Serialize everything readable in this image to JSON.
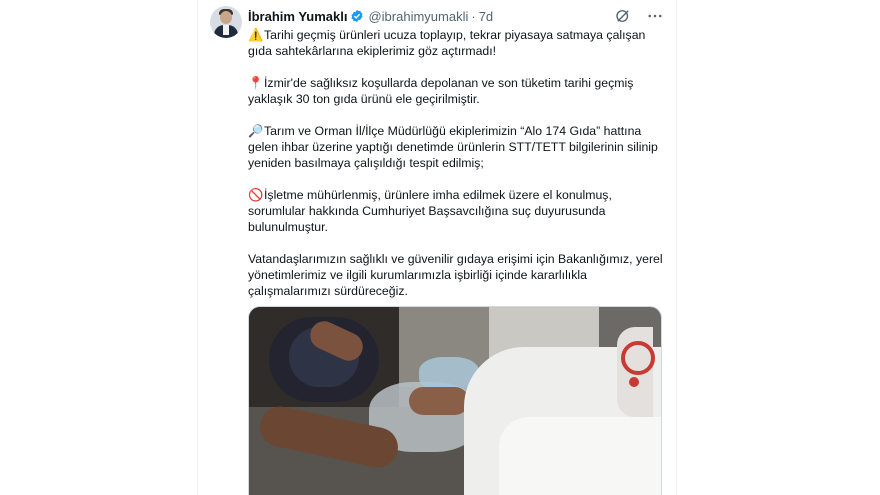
{
  "author": {
    "name": "İbrahim Yumaklı",
    "handle": "@ibrahimyumakli",
    "separator": "·",
    "time": "7d"
  },
  "icons": {
    "avatar": "avatar",
    "verified": "verified-badge-icon",
    "grok": "grok-icon",
    "more": "more-icon"
  },
  "tweet": {
    "paragraphs": [
      {
        "emoji": "⚠️",
        "text": "Tarihi geçmiş ürünleri ucuza toplayıp, tekrar piyasaya satmaya çalışan gıda sahtekârlarına ekiplerimiz göz açtırmadı!"
      },
      {
        "emoji": "📍",
        "text": "İzmir'de sağlıksız koşullarda depolanan ve son tüketim tarihi geçmiş yaklaşık 30 ton gıda ürünü ele geçirilmiştir."
      },
      {
        "emoji": "🔎",
        "text": "Tarım ve Orman İl/İlçe Müdürlüğü ekiplerimizin “Alo 174 Gıda” hattına gelen ihbar üzerine yaptığı denetimde ürünlerin STT/TETT bilgilerinin silinip yeniden basılmaya çalışıldığı tespit edilmiş;"
      },
      {
        "emoji": "🚫",
        "text": "İşletme mühürlenmiş, ürünlere imha edilmek üzere el konulmuş, sorumlular hakkında Cumhuriyet Başsavcılığına suç duyurusunda bulunulmuştur."
      },
      {
        "emoji": "",
        "text": "Vatandaşlarımızın sağlıklı ve güvenilir gıdaya erişimi için Bakanlığımız, yerel yönetimlerimiz ve ilgili kurumlarımızla işbirliği içinde kararlılıkla çalışmalarımızı sürdüreceğiz."
      }
    ]
  },
  "colors": {
    "text": "#0f1419",
    "secondary": "#536471",
    "verified": "#1d9bf0",
    "border": "#cfd9de"
  }
}
